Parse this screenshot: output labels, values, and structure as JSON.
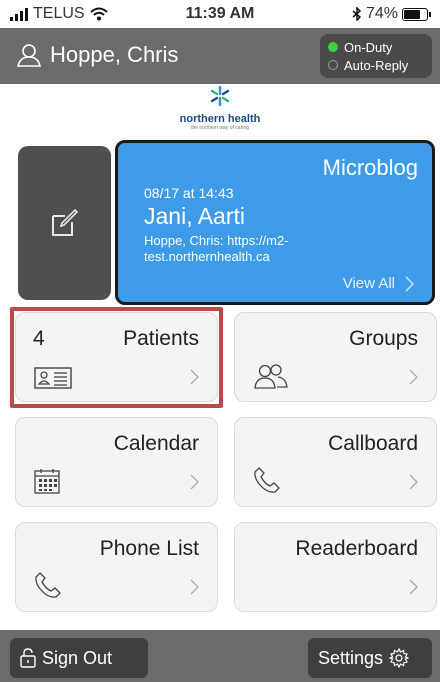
{
  "status_bar": {
    "carrier": "TELUS",
    "time": "11:39 AM",
    "battery": "74%",
    "battery_level": 0.74
  },
  "header": {
    "user_name": "Hoppe, Chris",
    "duty_status": "On-Duty",
    "auto_reply": "Auto-Reply",
    "colors": {
      "on_duty": "#3fcf3f",
      "header_bg": "#6b6b6b"
    }
  },
  "logo": {
    "name": "northern health",
    "tagline": "the northern way of caring"
  },
  "microblog": {
    "title": "Microblog",
    "date": "08/17 at 14:43",
    "author": "Jani, Aarti",
    "message": "Hoppe, Chris: https://m2-test.northernhealth.ca",
    "view_all": "View All",
    "color": "#3d9be9"
  },
  "tiles": {
    "patients": {
      "count": "4",
      "label": "Patients"
    },
    "groups": {
      "label": "Groups"
    },
    "calendar": {
      "label": "Calendar"
    },
    "callboard": {
      "label": "Callboard"
    },
    "phone_list": {
      "label": "Phone List"
    },
    "readerboard": {
      "label": "Readerboard"
    }
  },
  "bottom_bar": {
    "sign_out": "Sign Out",
    "settings": "Settings"
  }
}
